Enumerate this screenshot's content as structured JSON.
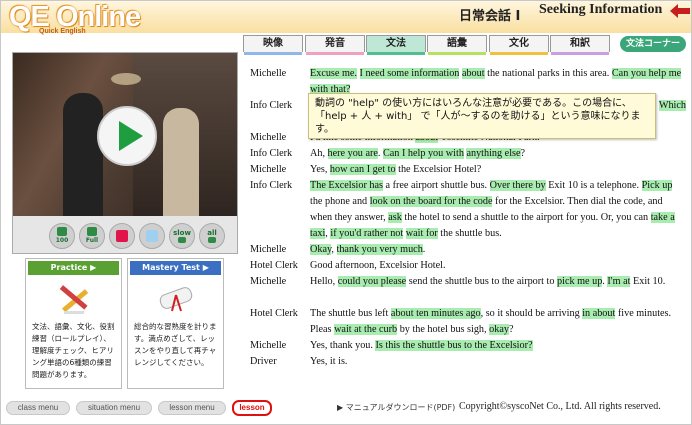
{
  "header": {
    "logo": "QE Online",
    "logo_sub": "Quick English",
    "lesson_number": "日常会話 I",
    "lesson_title": "Seeking Information"
  },
  "tabs": [
    {
      "label": "映像",
      "color": "#8fb8e8",
      "active": false
    },
    {
      "label": "発音",
      "color": "#f0a0c0",
      "active": false
    },
    {
      "label": "文法",
      "color": "#4fbf8f",
      "active": true
    },
    {
      "label": "語彙",
      "color": "#b8e060",
      "active": false
    },
    {
      "label": "文化",
      "color": "#f0c040",
      "active": false
    },
    {
      "label": "和訳",
      "color": "#c8a0e0",
      "active": false
    }
  ],
  "corner_button": "文法コーナー",
  "controls": {
    "btn1": "100",
    "btn2": "Full",
    "btn5": "slow",
    "btn6": "all"
  },
  "practice": {
    "title": "Practice",
    "arrow": "▶",
    "desc": "文法、語彙、文化、役割練習（ロールプレイ）、理解度チェック、ヒアリング単語の6種類の練習問題があります。"
  },
  "mastery": {
    "title": "Mastery Test",
    "arrow": "▶",
    "desc": "総合的な習熟度を計ります。満点めざして、レッスンをやり直して再チャレンジしてください。"
  },
  "tooltip": "動詞の \"help\" の使い方にはいろんな注意が必要である。この場合に、「help + 人 + with」 で「人が〜するのを助ける」という意味になります。",
  "dialogue": [
    {
      "speaker": "Michelle",
      "parts": [
        [
          "Excuse me.",
          true
        ],
        [
          " ",
          false
        ],
        [
          "I need some information",
          true
        ],
        [
          " ",
          false
        ],
        [
          "about",
          true
        ],
        [
          " the national parks in this area. ",
          false
        ],
        [
          "Can you help me with that?",
          true
        ]
      ]
    },
    {
      "speaker": "Info Clerk",
      "parts": [
        [
          "Which",
          true
        ]
      ]
    },
    {
      "speaker": "Michelle",
      "parts": [
        [
          "I'd like some information ",
          false
        ],
        [
          "about",
          true
        ],
        [
          " Yosemite National Park.",
          false
        ]
      ]
    },
    {
      "speaker": "Info Clerk",
      "parts": [
        [
          "Ah, ",
          false
        ],
        [
          "here you are",
          true
        ],
        [
          ". ",
          false
        ],
        [
          "Can I help you with",
          true
        ],
        [
          " ",
          false
        ],
        [
          "anything else",
          true
        ],
        [
          "?",
          false
        ]
      ]
    },
    {
      "speaker": "Michelle",
      "parts": [
        [
          "Yes, ",
          false
        ],
        [
          "how can I get to",
          true
        ],
        [
          " the Excelsior Hotel?",
          false
        ]
      ]
    },
    {
      "speaker": "Info Clerk",
      "parts": [
        [
          "The Excelsior has",
          true
        ],
        [
          " a free airport shuttle bus. ",
          false
        ],
        [
          "Over there by",
          true
        ],
        [
          " Exit 10 is a telephone. ",
          false
        ],
        [
          "Pick up",
          true
        ],
        [
          " the phone and ",
          false
        ],
        [
          "look on the board for the code",
          true
        ],
        [
          " for the Excelsior. Then dial the code, and when they answer, ",
          false
        ],
        [
          "ask",
          true
        ],
        [
          " the hotel to send a shuttle to the airport for you. Or, you can ",
          false
        ],
        [
          "take a taxi",
          true
        ],
        [
          ", ",
          false
        ],
        [
          "if you'd rather not",
          true
        ],
        [
          " ",
          false
        ],
        [
          "wait for",
          true
        ],
        [
          " the shuttle bus.",
          false
        ]
      ]
    },
    {
      "speaker": "Michelle",
      "parts": [
        [
          "Okay",
          true
        ],
        [
          ", ",
          false
        ],
        [
          "thank you very much",
          true
        ],
        [
          ".",
          false
        ]
      ]
    },
    {
      "speaker": "Hotel Clerk",
      "parts": [
        [
          "Good afternoon, Excelsior Hotel.",
          false
        ]
      ]
    },
    {
      "speaker": "Michelle",
      "parts": [
        [
          "Hello, ",
          false
        ],
        [
          "could you please",
          true
        ],
        [
          " send the shuttle bus to the airport to ",
          false
        ],
        [
          "pick me up",
          true
        ],
        [
          ". ",
          false
        ],
        [
          "I'm at",
          true
        ],
        [
          " Exit 10.",
          false
        ]
      ]
    },
    {
      "speaker": "Hotel Clerk",
      "parts": [
        [
          "The shuttle bus left ",
          false
        ],
        [
          "about ten minutes ago",
          true
        ],
        [
          ", so it should be arriving ",
          false
        ],
        [
          "in about",
          true
        ],
        [
          " five minutes. Pleas ",
          false
        ],
        [
          "wait at the curb",
          true
        ],
        [
          " by the hotel bus sigh, ",
          false
        ],
        [
          "okay",
          true
        ],
        [
          "?",
          false
        ]
      ]
    },
    {
      "speaker": "Michelle",
      "parts": [
        [
          "Yes, thank you. ",
          false
        ],
        [
          "Is this the shuttle bus to the Excelsior?",
          true
        ]
      ]
    },
    {
      "speaker": "Driver",
      "parts": [
        [
          "Yes, it is.",
          false
        ]
      ]
    }
  ],
  "footer": {
    "nav": [
      {
        "label": "class menu",
        "active": false
      },
      {
        "label": "situation menu",
        "active": false
      },
      {
        "label": "lesson menu",
        "active": false
      },
      {
        "label": "lesson",
        "active": true
      }
    ],
    "manual": "▶ マニュアルダウンロード(PDF)",
    "copyright": "Copyright©syscoNet Co., Ltd. All rights reserved."
  }
}
